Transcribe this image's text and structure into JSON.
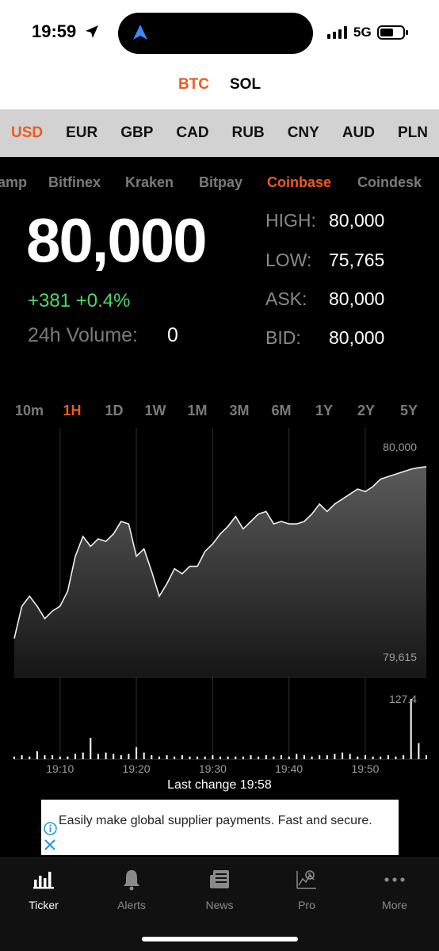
{
  "status_bar": {
    "time": "19:59",
    "network": "5G",
    "icons": [
      "location-arrow-icon",
      "navigation-arrow-icon",
      "signal-bars-icon",
      "battery-icon"
    ]
  },
  "coin_tabs": [
    {
      "label": "BTC",
      "active": true
    },
    {
      "label": "SOL",
      "active": false
    }
  ],
  "currencies": [
    {
      "label": "USD",
      "active": true
    },
    {
      "label": "EUR",
      "active": false
    },
    {
      "label": "GBP",
      "active": false
    },
    {
      "label": "CAD",
      "active": false
    },
    {
      "label": "RUB",
      "active": false
    },
    {
      "label": "CNY",
      "active": false
    },
    {
      "label": "AUD",
      "active": false
    },
    {
      "label": "PLN",
      "active": false
    }
  ],
  "exchanges": [
    {
      "label": "amp",
      "active": false
    },
    {
      "label": "Bitfinex",
      "active": false
    },
    {
      "label": "Kraken",
      "active": false
    },
    {
      "label": "Bitpay",
      "active": false
    },
    {
      "label": "Coinbase",
      "active": true
    },
    {
      "label": "Coindesk",
      "active": false
    }
  ],
  "ticker": {
    "price": "80,000",
    "change": "+381 +0.4%",
    "volume_label": "24h Volume:",
    "volume_value": "0"
  },
  "stats": [
    {
      "label": "HIGH:",
      "value": "80,000"
    },
    {
      "label": "LOW:",
      "value": "75,765"
    },
    {
      "label": "ASK:",
      "value": "80,000"
    },
    {
      "label": "BID:",
      "value": "80,000"
    }
  ],
  "ranges": [
    {
      "label": "10m",
      "active": false
    },
    {
      "label": "1H",
      "active": true
    },
    {
      "label": "1D",
      "active": false
    },
    {
      "label": "1W",
      "active": false
    },
    {
      "label": "1M",
      "active": false
    },
    {
      "label": "3M",
      "active": false
    },
    {
      "label": "6M",
      "active": false
    },
    {
      "label": "1Y",
      "active": false
    },
    {
      "label": "2Y",
      "active": false
    },
    {
      "label": "5Y",
      "active": false
    }
  ],
  "chart_data": {
    "type": "area",
    "x": [
      "19:04",
      "19:05",
      "19:06",
      "19:07",
      "19:08",
      "19:09",
      "19:10",
      "19:11",
      "19:12",
      "19:13",
      "19:14",
      "19:15",
      "19:16",
      "19:17",
      "19:18",
      "19:19",
      "19:20",
      "19:21",
      "19:22",
      "19:23",
      "19:24",
      "19:25",
      "19:26",
      "19:27",
      "19:28",
      "19:29",
      "19:30",
      "19:31",
      "19:32",
      "19:33",
      "19:34",
      "19:35",
      "19:36",
      "19:37",
      "19:38",
      "19:39",
      "19:40",
      "19:41",
      "19:42",
      "19:43",
      "19:44",
      "19:45",
      "19:46",
      "19:47",
      "19:48",
      "19:49",
      "19:50",
      "19:51",
      "19:52",
      "19:53",
      "19:54",
      "19:55",
      "19:56",
      "19:57",
      "19:58"
    ],
    "series": [
      {
        "values": [
          79625,
          79690,
          79710,
          79690,
          79665,
          79680,
          79690,
          79720,
          79790,
          79830,
          79810,
          79825,
          79820,
          79835,
          79860,
          79855,
          79790,
          79805,
          79760,
          79710,
          79735,
          79765,
          79755,
          79770,
          79770,
          79800,
          79815,
          79835,
          79850,
          79870,
          79845,
          79860,
          79875,
          79880,
          79855,
          79860,
          79855,
          79855,
          79860,
          79875,
          79895,
          79880,
          79895,
          79905,
          79915,
          79925,
          79920,
          79930,
          79945,
          79950,
          79955,
          79960,
          79965,
          79968,
          79970
        ]
      },
      {
        "name": "Volume",
        "values": [
          2,
          3,
          2,
          6,
          3,
          3,
          2,
          2,
          4,
          5,
          16,
          4,
          5,
          4,
          3,
          4,
          9,
          5,
          3,
          2,
          3,
          2,
          3,
          2,
          2,
          2,
          3,
          2,
          2,
          2,
          2,
          3,
          2,
          3,
          2,
          3,
          2,
          4,
          3,
          2,
          3,
          3,
          4,
          5,
          4,
          2,
          3,
          2,
          2,
          3,
          2,
          3,
          45,
          12,
          3
        ]
      }
    ],
    "ylim": [
      79615,
      80000
    ],
    "y_labels": {
      "max": "80,000",
      "min": "79,615"
    },
    "volume_max_label": "127.4",
    "x_ticks": [
      "19:10",
      "19:20",
      "19:30",
      "19:40",
      "19:50"
    ],
    "grid": true
  },
  "last_change": "Last change 19:58",
  "ad": {
    "text": "Easily make global supplier payments. Fast and secure."
  },
  "tabs": [
    {
      "label": "Ticker",
      "icon": "bar-chart-icon",
      "active": true
    },
    {
      "label": "Alerts",
      "icon": "bell-icon",
      "active": false
    },
    {
      "label": "News",
      "icon": "newspaper-icon",
      "active": false
    },
    {
      "label": "Pro",
      "icon": "pro-chart-icon",
      "active": false
    },
    {
      "label": "More",
      "icon": "more-dots-icon",
      "active": false
    }
  ],
  "colors": {
    "accent": "#ee5a1f",
    "positive": "#4cd964",
    "background": "#000000"
  }
}
